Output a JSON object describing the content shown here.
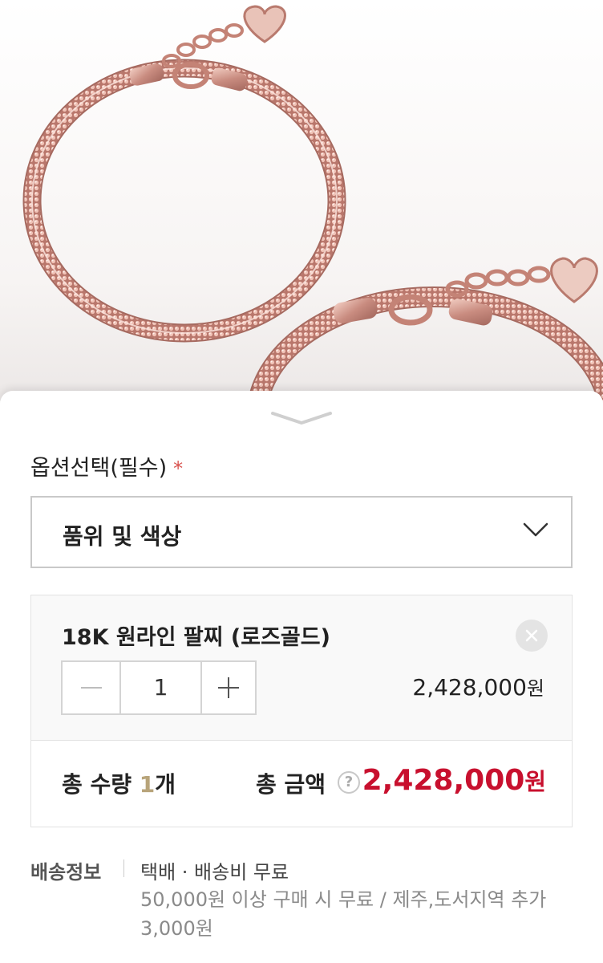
{
  "hero": {
    "image": "rose gold bracelet product photo",
    "icon": "bracelet-image"
  },
  "sheet": {
    "handle_icon": "chevron-down-icon"
  },
  "option": {
    "label": "옵션선택(필수)",
    "required_mark": "*",
    "select": {
      "value": "품위 및 색상",
      "icon": "chevron-down-icon"
    }
  },
  "item": {
    "name": "18K 원라인 팔찌 (로즈골드)",
    "quantity": "1",
    "price": "2,428,000",
    "currency": "원",
    "remove_icon": "close-icon",
    "minus_icon": "minus-icon",
    "plus_icon": "plus-icon"
  },
  "summary": {
    "qty_label": "총 수량",
    "qty_value": "1",
    "qty_unit": "개",
    "amount_label": "총 금액",
    "help_icon": "?",
    "amount_value": "2,428,000",
    "currency": "원"
  },
  "shipping": {
    "label": "배송정보",
    "method": "택배 · 배송비 무료",
    "note": "50,000원 이상 구매 시 무료 / 제주,도서지역 추가 3,000원"
  },
  "colors": {
    "price_red": "#c8102e",
    "required_red": "#d9534f",
    "qty_gold": "#b8a47a",
    "rose_gold": "#c98c80"
  }
}
